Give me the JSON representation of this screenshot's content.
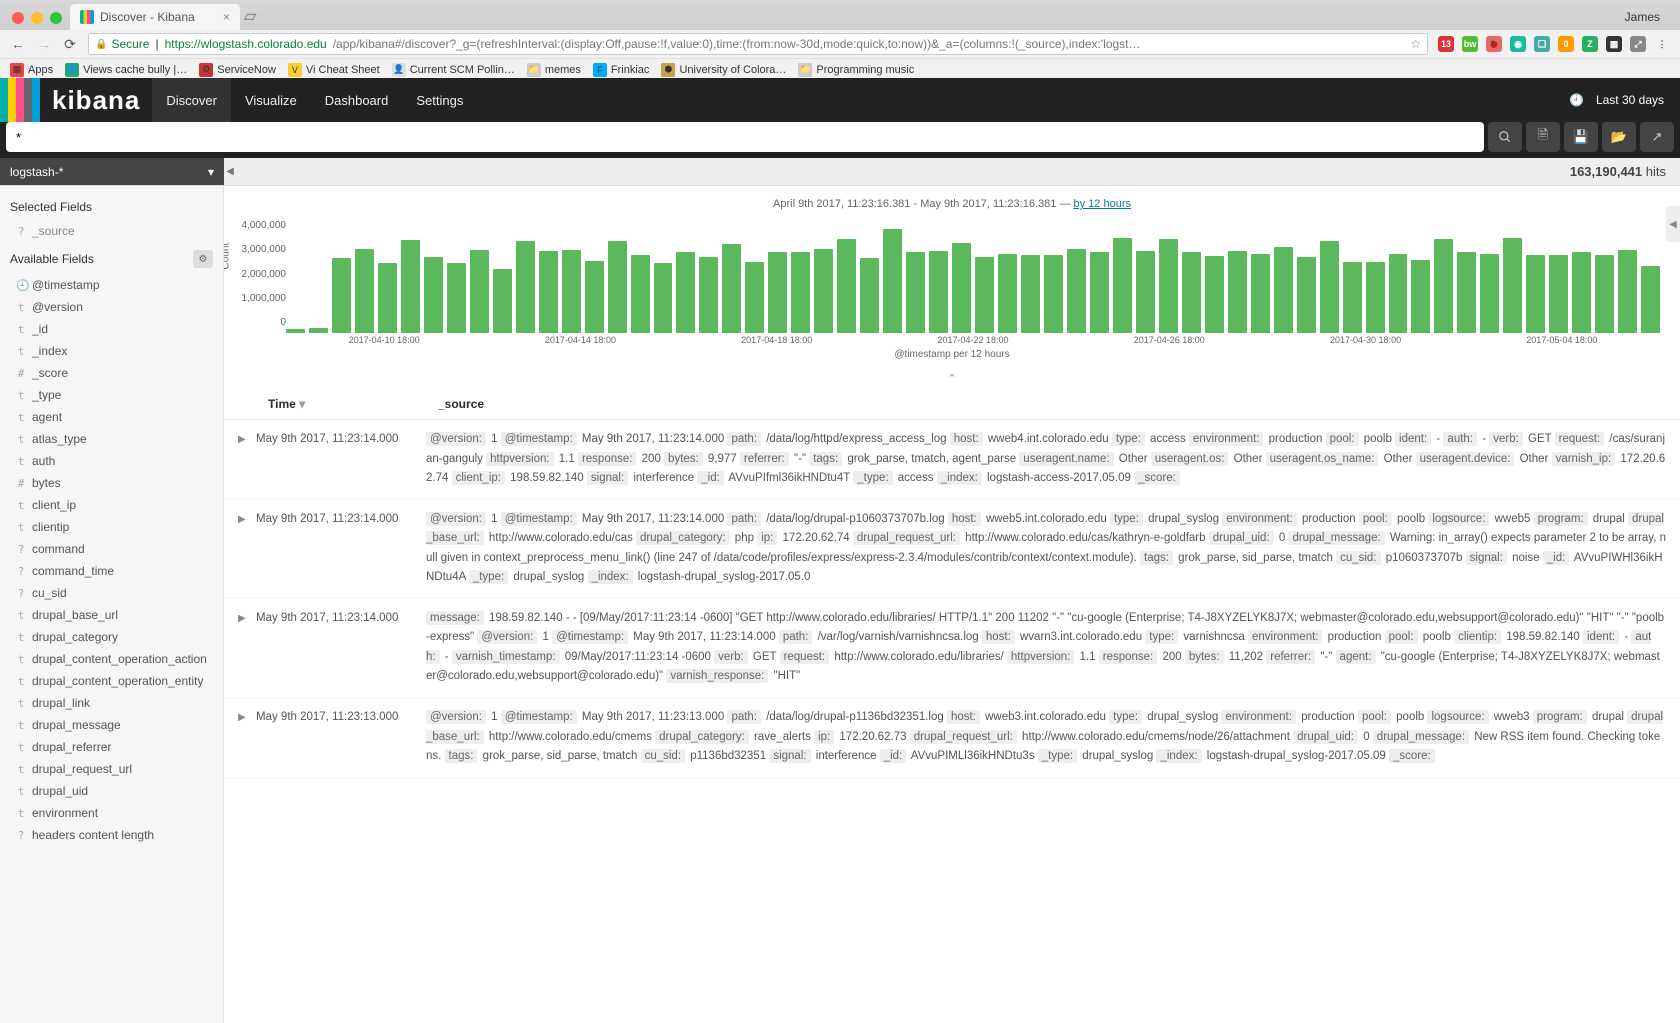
{
  "browser": {
    "user": "James",
    "tab": {
      "title": "Discover - Kibana"
    },
    "address": {
      "secure_label": "Secure",
      "host": "https://wlogstash.colorado.edu",
      "path": "/app/kibana#/discover?_g=(refreshInterval:(display:Off,pause:!f,value:0),time:(from:now-30d,mode:quick,to:now))&_a=(columns:!(_source),index:'logst…"
    },
    "ext_icons": [
      {
        "bg": "#d33",
        "txt": "13"
      },
      {
        "bg": "#5b3",
        "txt": "bw"
      },
      {
        "bg": "#e66",
        "txt": "🐞"
      },
      {
        "bg": "#1abc9c",
        "txt": "◉"
      },
      {
        "bg": "#4aa",
        "txt": "❑"
      },
      {
        "bg": "#f90",
        "txt": "0"
      },
      {
        "bg": "#27ae60",
        "txt": "Z"
      },
      {
        "bg": "#333",
        "txt": "▦"
      },
      {
        "bg": "#888",
        "txt": "⤢"
      },
      {
        "bg": "transparent",
        "txt": "⋮"
      }
    ],
    "bookmarks": [
      {
        "ico": "▦",
        "bg": "#e44",
        "label": "Apps"
      },
      {
        "ico": "🌀",
        "bg": "#2a6",
        "label": "Views cache bully |…"
      },
      {
        "ico": "⚙",
        "bg": "#c33",
        "label": "ServiceNow"
      },
      {
        "ico": "V",
        "bg": "#fc3",
        "label": "Vi Cheat Sheet"
      },
      {
        "ico": "👤",
        "bg": "#ddd",
        "label": "Current SCM Pollin…"
      },
      {
        "ico": "📁",
        "bg": "#ccc",
        "label": "memes"
      },
      {
        "ico": "F",
        "bg": "#0af",
        "label": "Frinkiac"
      },
      {
        "ico": "⬢",
        "bg": "#c4a24a",
        "label": "University of Colora…"
      },
      {
        "ico": "📁",
        "bg": "#ccc",
        "label": "Programming music"
      }
    ]
  },
  "nav": {
    "logo": "kibana",
    "tabs": [
      "Discover",
      "Visualize",
      "Dashboard",
      "Settings"
    ],
    "active": 0,
    "time_label": "Last 30 days"
  },
  "search": {
    "query": "*"
  },
  "index_pattern": "logstash-*",
  "hits_count": "163,190,441",
  "hits_label": "hits",
  "timeline_label": "April 9th 2017, 11:23:16.381 - May 9th 2017, 11:23:16.381 — ",
  "timeline_link": "by 12 hours",
  "chart_data": {
    "type": "bar",
    "ylabel": "Count",
    "xlabel": "@timestamp per 12 hours",
    "y_ticks": [
      "4,000,000",
      "3,000,000",
      "2,000,000",
      "1,000,000",
      "0"
    ],
    "x_ticks": [
      "2017-04-10 18:00",
      "2017-04-14 18:00",
      "2017-04-18 18:00",
      "2017-04-22 18:00",
      "2017-04-26 18:00",
      "2017-04-30 18:00",
      "2017-05-04 18:00"
    ],
    "ylim": [
      0,
      4500000
    ],
    "values": [
      150000,
      200000,
      3050000,
      3450000,
      2850000,
      3800000,
      3100000,
      2850000,
      3400000,
      2600000,
      3750000,
      3350000,
      3400000,
      2950000,
      3750000,
      3200000,
      2850000,
      3300000,
      3100000,
      3650000,
      2900000,
      3300000,
      3300000,
      3450000,
      3850000,
      3050000,
      4250000,
      3300000,
      3350000,
      3700000,
      3100000,
      3250000,
      3200000,
      3200000,
      3450000,
      3300000,
      3900000,
      3350000,
      3850000,
      3300000,
      3150000,
      3350000,
      3250000,
      3500000,
      3100000,
      3750000,
      2900000,
      2900000,
      3250000,
      3000000,
      3850000,
      3300000,
      3220000,
      3900000,
      3200000,
      3200000,
      3300000,
      3200000,
      3400000,
      2750000
    ]
  },
  "sidebar": {
    "selected_h": "Selected Fields",
    "selected": [
      {
        "t": "?",
        "n": "_source"
      }
    ],
    "available_h": "Available Fields",
    "available": [
      {
        "t": "🕘",
        "n": "@timestamp"
      },
      {
        "t": "t",
        "n": "@version"
      },
      {
        "t": "t",
        "n": "_id"
      },
      {
        "t": "t",
        "n": "_index"
      },
      {
        "t": "#",
        "n": "_score"
      },
      {
        "t": "t",
        "n": "_type"
      },
      {
        "t": "t",
        "n": "agent"
      },
      {
        "t": "t",
        "n": "atlas_type"
      },
      {
        "t": "t",
        "n": "auth"
      },
      {
        "t": "#",
        "n": "bytes"
      },
      {
        "t": "t",
        "n": "client_ip"
      },
      {
        "t": "t",
        "n": "clientip"
      },
      {
        "t": "?",
        "n": "command"
      },
      {
        "t": "?",
        "n": "command_time"
      },
      {
        "t": "?",
        "n": "cu_sid"
      },
      {
        "t": "t",
        "n": "drupal_base_url"
      },
      {
        "t": "t",
        "n": "drupal_category"
      },
      {
        "t": "t",
        "n": "drupal_content_operation_action"
      },
      {
        "t": "t",
        "n": "drupal_content_operation_entity"
      },
      {
        "t": "t",
        "n": "drupal_link"
      },
      {
        "t": "t",
        "n": "drupal_message"
      },
      {
        "t": "t",
        "n": "drupal_referrer"
      },
      {
        "t": "t",
        "n": "drupal_request_url"
      },
      {
        "t": "t",
        "n": "drupal_uid"
      },
      {
        "t": "t",
        "n": "environment"
      },
      {
        "t": "?",
        "n": "headers content length"
      }
    ]
  },
  "table": {
    "cols": [
      "Time",
      "_source"
    ],
    "rows": [
      {
        "time": "May 9th 2017, 11:23:14.000",
        "src": [
          [
            "@version:",
            "1"
          ],
          [
            "@timestamp:",
            "May 9th 2017, 11:23:14.000"
          ],
          [
            "path:",
            "/data/log/httpd/express_access_log"
          ],
          [
            "host:",
            "wweb4.int.colorado.edu"
          ],
          [
            "type:",
            "access"
          ],
          [
            "environment:",
            "production"
          ],
          [
            "pool:",
            "poolb"
          ],
          [
            "ident:",
            "-"
          ],
          [
            "auth:",
            "-"
          ],
          [
            "verb:",
            "GET"
          ],
          [
            "request:",
            "/cas/suranjan-ganguly"
          ],
          [
            "httpversion:",
            "1.1"
          ],
          [
            "response:",
            "200"
          ],
          [
            "bytes:",
            "9,977"
          ],
          [
            "referrer:",
            "\"-\""
          ],
          [
            "tags:",
            "grok_parse, tmatch, agent_parse"
          ],
          [
            "useragent.name:",
            "Other"
          ],
          [
            "useragent.os:",
            "Other"
          ],
          [
            "useragent.os_name:",
            "Other"
          ],
          [
            "useragent.device:",
            "Other"
          ],
          [
            "varnish_ip:",
            "172.20.62.74"
          ],
          [
            "client_ip:",
            "198.59.82.140"
          ],
          [
            "signal:",
            "interference"
          ],
          [
            "_id:",
            "AVvuPIfml36ikHNDtu4T"
          ],
          [
            "_type:",
            "access"
          ],
          [
            "_index:",
            "logstash-access-2017.05.09"
          ],
          [
            "_score:",
            ""
          ]
        ]
      },
      {
        "time": "May 9th 2017, 11:23:14.000",
        "src": [
          [
            "@version:",
            "1"
          ],
          [
            "@timestamp:",
            "May 9th 2017, 11:23:14.000"
          ],
          [
            "path:",
            "/data/log/drupal-p1060373707b.log"
          ],
          [
            "host:",
            "wweb5.int.colorado.edu"
          ],
          [
            "type:",
            "drupal_syslog"
          ],
          [
            "environment:",
            "production"
          ],
          [
            "pool:",
            "poolb"
          ],
          [
            "logsource:",
            "wweb5"
          ],
          [
            "program:",
            "drupal"
          ],
          [
            "drupal_base_url:",
            "http://www.colorado.edu/cas"
          ],
          [
            "drupal_category:",
            "php"
          ],
          [
            "ip:",
            "172.20.62.74"
          ],
          [
            "drupal_request_url:",
            "http://www.colorado.edu/cas/kathryn-e-goldfarb"
          ],
          [
            "drupal_uid:",
            "0"
          ],
          [
            "drupal_message:",
            "Warning: in_array() expects parameter 2 to be array, null given in context_preprocess_menu_link() (line 247 of /data/code/profiles/express/express-2.3.4/modules/contrib/context/context.module)."
          ],
          [
            "tags:",
            "grok_parse, sid_parse, tmatch"
          ],
          [
            "cu_sid:",
            "p1060373707b"
          ],
          [
            "signal:",
            "noise"
          ],
          [
            "_id:",
            "AVvuPIWHl36ikHNDtu4A"
          ],
          [
            "_type:",
            "drupal_syslog"
          ],
          [
            "_index:",
            "logstash-drupal_syslog-2017.05.0"
          ]
        ]
      },
      {
        "time": "May 9th 2017, 11:23:14.000",
        "src": [
          [
            "message:",
            "198.59.82.140 - - [09/May/2017:11:23:14 -0600] \"GET http://www.colorado.edu/libraries/ HTTP/1.1\" 200 11202 \"-\" \"cu-google (Enterprise; T4-J8XYZELYK8J7X; webmaster@colorado.edu,websupport@colorado.edu)\" \"HIT\" \"-\" \"poolb-express\""
          ],
          [
            "@version:",
            "1"
          ],
          [
            "@timestamp:",
            "May 9th 2017, 11:23:14.000"
          ],
          [
            "path:",
            "/var/log/varnish/varnishncsa.log"
          ],
          [
            "host:",
            "wvarn3.int.colorado.edu"
          ],
          [
            "type:",
            "varnishncsa"
          ],
          [
            "environment:",
            "production"
          ],
          [
            "pool:",
            "poolb"
          ],
          [
            "clientip:",
            "198.59.82.140"
          ],
          [
            "ident:",
            "-"
          ],
          [
            "auth:",
            "-"
          ],
          [
            "varnish_timestamp:",
            "09/May/2017:11:23:14 -0600"
          ],
          [
            "verb:",
            "GET"
          ],
          [
            "request:",
            "http://www.colorado.edu/libraries/"
          ],
          [
            "httpversion:",
            "1.1"
          ],
          [
            "response:",
            "200"
          ],
          [
            "bytes:",
            "11,202"
          ],
          [
            "referrer:",
            "\"-\""
          ],
          [
            "agent:",
            "\"cu-google (Enterprise; T4-J8XYZELYK8J7X; webmaster@colorado.edu,websupport@colorado.edu)\""
          ],
          [
            "varnish_response:",
            "\"HIT\""
          ]
        ]
      },
      {
        "time": "May 9th 2017, 11:23:13.000",
        "src": [
          [
            "@version:",
            "1"
          ],
          [
            "@timestamp:",
            "May 9th 2017, 11:23:13.000"
          ],
          [
            "path:",
            "/data/log/drupal-p1136bd32351.log"
          ],
          [
            "host:",
            "wweb3.int.colorado.edu"
          ],
          [
            "type:",
            "drupal_syslog"
          ],
          [
            "environment:",
            "production"
          ],
          [
            "pool:",
            "poolb"
          ],
          [
            "logsource:",
            "wweb3"
          ],
          [
            "program:",
            "drupal"
          ],
          [
            "drupal_base_url:",
            "http://www.colorado.edu/cmems"
          ],
          [
            "drupal_category:",
            "rave_alerts"
          ],
          [
            "ip:",
            "172.20.62.73"
          ],
          [
            "drupal_request_url:",
            "http://www.colorado.edu/cmems/node/26/attachment"
          ],
          [
            "drupal_uid:",
            "0"
          ],
          [
            "drupal_message:",
            "New RSS item found. Checking tokens."
          ],
          [
            "tags:",
            "grok_parse, sid_parse, tmatch"
          ],
          [
            "cu_sid:",
            "p1136bd32351"
          ],
          [
            "signal:",
            "interference"
          ],
          [
            "_id:",
            "AVvuPIMLl36ikHNDtu3s"
          ],
          [
            "_type:",
            "drupal_syslog"
          ],
          [
            "_index:",
            "logstash-drupal_syslog-2017.05.09"
          ],
          [
            "_score:",
            ""
          ]
        ]
      }
    ]
  }
}
